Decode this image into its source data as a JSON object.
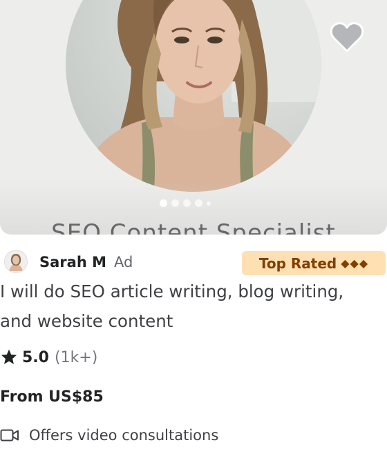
{
  "gallery": {
    "subtitle": "SEO Content Specialist",
    "dots_count": 5,
    "active_dot": 1
  },
  "favorite": {
    "icon": "heart-icon"
  },
  "seller": {
    "name": "Sarah M",
    "ad_label": "Ad",
    "badge": {
      "label": "Top Rated",
      "diamonds": "◆◆◆",
      "color": "#ffe0b3"
    }
  },
  "gig": {
    "title_line1": "I will do SEO article writing, blog writing,",
    "title_line2": "and website content"
  },
  "rating": {
    "icon": "star-icon",
    "value": "5.0",
    "count": "(1k+)"
  },
  "price": {
    "label": "From US$85"
  },
  "consultation": {
    "icon": "video-camera-icon",
    "label": "Offers video consultations"
  }
}
